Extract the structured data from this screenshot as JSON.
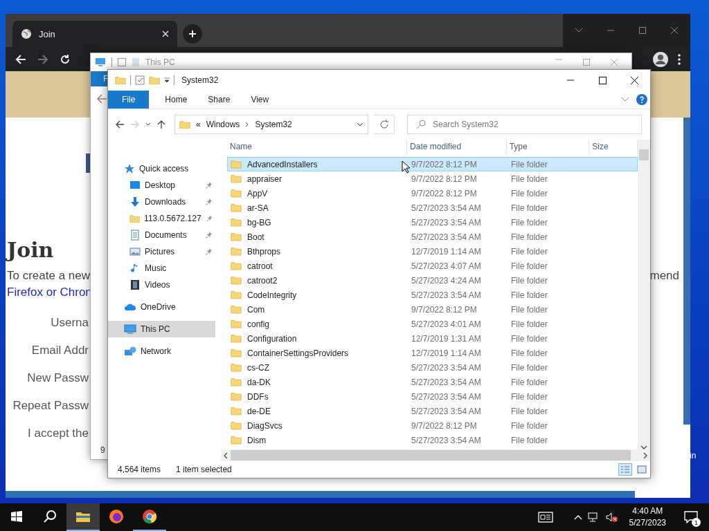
{
  "desktop": {
    "corner_text": "in"
  },
  "browser": {
    "tab": {
      "title": "Join"
    },
    "page": {
      "heading": "Join",
      "intro": "To create a new",
      "intro_end": "mend",
      "link": "Firefox or Chron",
      "form_labels": [
        "Userna",
        "Email Addr",
        "New Passw",
        "Repeat Passw",
        "I accept the"
      ]
    }
  },
  "back_window": {
    "title": "This PC",
    "ribbon_tab": "F",
    "status": "9"
  },
  "explorer": {
    "title": "System32",
    "ribbon_tabs": [
      {
        "label": "File",
        "selected": true
      },
      {
        "label": "Home",
        "selected": false
      },
      {
        "label": "Share",
        "selected": false
      },
      {
        "label": "View",
        "selected": false
      }
    ],
    "path_overflow": "«",
    "breadcrumb": [
      "Windows",
      "System32"
    ],
    "search": {
      "placeholder": "Search System32"
    },
    "nav": [
      {
        "label": "Quick access",
        "selected": false,
        "children": [
          {
            "label": "Desktop",
            "pinned": true,
            "selected": false
          },
          {
            "label": "Downloads",
            "pinned": true,
            "selected": false
          },
          {
            "label": "113.0.5672.127",
            "pinned": true,
            "selected": false
          },
          {
            "label": "Documents",
            "pinned": true,
            "selected": false
          },
          {
            "label": "Pictures",
            "pinned": true,
            "selected": false
          },
          {
            "label": "Music",
            "pinned": false,
            "selected": false
          },
          {
            "label": "Videos",
            "pinned": false,
            "selected": false
          }
        ]
      },
      {
        "label": "OneDrive",
        "selected": false
      },
      {
        "label": "This PC",
        "selected": true
      },
      {
        "label": "Network",
        "selected": false
      }
    ],
    "columns": [
      "Name",
      "Date modified",
      "Type",
      "Size"
    ],
    "rows": [
      {
        "name": "AdvancedInstallers",
        "date": "9/7/2022 8:12 PM",
        "type": "File folder",
        "selected": true
      },
      {
        "name": "appraiser",
        "date": "9/7/2022 8:12 PM",
        "type": "File folder",
        "selected": false
      },
      {
        "name": "AppV",
        "date": "9/7/2022 8:12 PM",
        "type": "File folder",
        "selected": false
      },
      {
        "name": "ar-SA",
        "date": "5/27/2023 3:54 AM",
        "type": "File folder",
        "selected": false
      },
      {
        "name": "bg-BG",
        "date": "5/27/2023 3:54 AM",
        "type": "File folder",
        "selected": false
      },
      {
        "name": "Boot",
        "date": "5/27/2023 3:54 AM",
        "type": "File folder",
        "selected": false
      },
      {
        "name": "Bthprops",
        "date": "12/7/2019 1:14 AM",
        "type": "File folder",
        "selected": false
      },
      {
        "name": "catroot",
        "date": "5/27/2023 4:07 AM",
        "type": "File folder",
        "selected": false
      },
      {
        "name": "catroot2",
        "date": "5/27/2023 4:24 AM",
        "type": "File folder",
        "selected": false
      },
      {
        "name": "CodeIntegrity",
        "date": "5/27/2023 3:54 AM",
        "type": "File folder",
        "selected": false
      },
      {
        "name": "Com",
        "date": "9/7/2022 8:12 PM",
        "type": "File folder",
        "selected": false
      },
      {
        "name": "config",
        "date": "5/27/2023 4:01 AM",
        "type": "File folder",
        "selected": false
      },
      {
        "name": "Configuration",
        "date": "12/7/2019 1:31 AM",
        "type": "File folder",
        "selected": false
      },
      {
        "name": "ContainerSettingsProviders",
        "date": "12/7/2019 1:14 AM",
        "type": "File folder",
        "selected": false
      },
      {
        "name": "cs-CZ",
        "date": "5/27/2023 3:54 AM",
        "type": "File folder",
        "selected": false
      },
      {
        "name": "da-DK",
        "date": "5/27/2023 3:54 AM",
        "type": "File folder",
        "selected": false
      },
      {
        "name": "DDFs",
        "date": "5/27/2023 3:54 AM",
        "type": "File folder",
        "selected": false
      },
      {
        "name": "de-DE",
        "date": "5/27/2023 3:54 AM",
        "type": "File folder",
        "selected": false
      },
      {
        "name": "DiagSvcs",
        "date": "9/7/2022 8:12 PM",
        "type": "File folder",
        "selected": false
      },
      {
        "name": "Dism",
        "date": "5/27/2023 3:54 AM",
        "type": "File folder",
        "selected": false
      }
    ],
    "status": {
      "count": "4,564 items",
      "selection": "1 item selected"
    }
  },
  "taskbar": {
    "time": "4:40 AM",
    "date": "5/27/2023",
    "notification_count": "1"
  }
}
